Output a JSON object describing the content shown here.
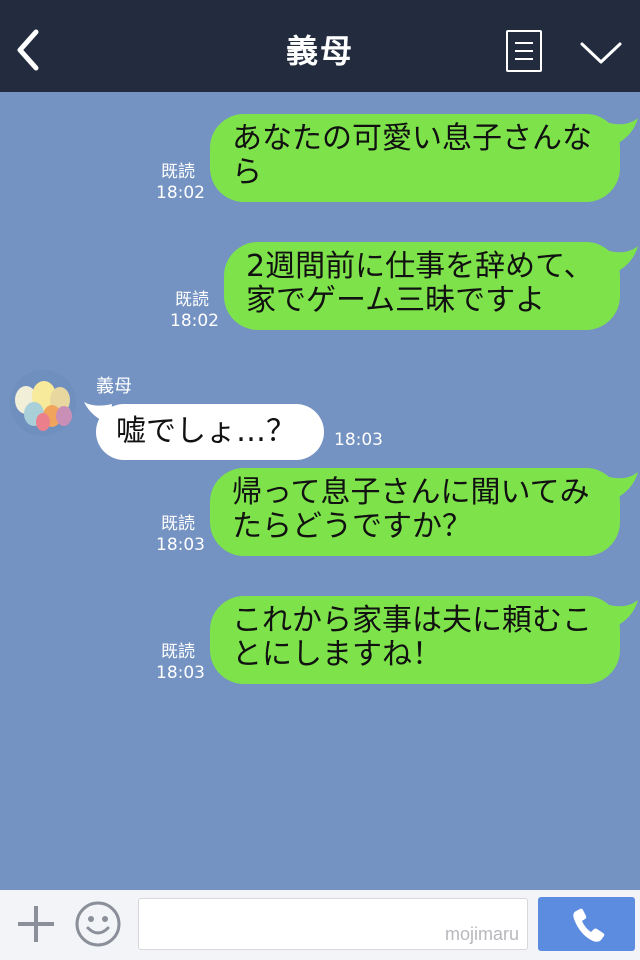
{
  "header": {
    "title": "義母",
    "icons": [
      "chevron-left-icon",
      "menu-icon",
      "chevron-down-icon"
    ]
  },
  "messages": [
    {
      "direction": "out",
      "lines": [
        "あなたの可愛い息子さんな",
        "ら"
      ],
      "read": "既読",
      "time": "18:02"
    },
    {
      "direction": "out",
      "lines": [
        "2週間前に仕事を辞めて、",
        "家でゲーム三昧ですよ"
      ],
      "read": "既読",
      "time": "18:02"
    },
    {
      "direction": "in",
      "sender": "義母",
      "lines": [
        "嘘でしょ…？"
      ],
      "time": "18:03"
    },
    {
      "direction": "out",
      "lines": [
        "帰って息子さんに聞いてみ",
        "たらどうですか？"
      ],
      "read": "既読",
      "time": "18:03"
    },
    {
      "direction": "out",
      "lines": [
        "これから家事は夫に頼むこ",
        "とにしますね！"
      ],
      "read": "既読",
      "time": "18:03"
    }
  ],
  "footer": {
    "watermark": "mojimaru",
    "icons": [
      "plus-icon",
      "smile-icon",
      "phone-icon"
    ]
  },
  "colors": {
    "header_bg": "#232c3f",
    "chat_bg": "#7493c2",
    "outgoing_bubble": "#7ee34a",
    "incoming_bubble": "#ffffff",
    "call_button": "#5b8ce0"
  }
}
